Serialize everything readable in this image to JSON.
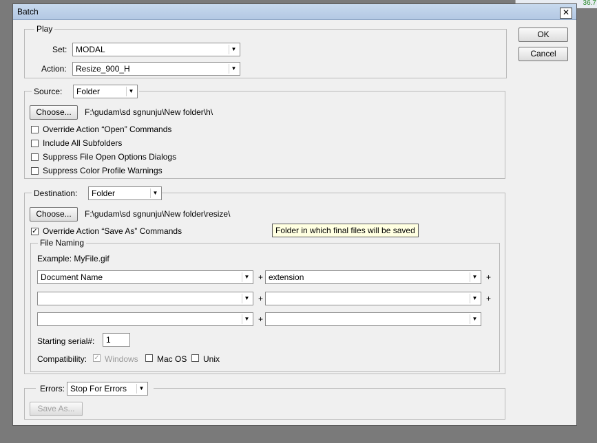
{
  "window": {
    "title": "Batch",
    "close_glyph": "✕"
  },
  "corner": {
    "zoom_text": "36.7"
  },
  "buttons": {
    "ok": "OK",
    "cancel": "Cancel"
  },
  "play": {
    "legend": "Play",
    "set_label": "Set:",
    "set_value": "MODAL",
    "action_label": "Action:",
    "action_value": "Resize_900_H"
  },
  "source": {
    "legend": "Source:",
    "value": "Folder",
    "choose_label": "Choose...",
    "path": "F:\\gudam\\sd sgnunju\\New folder\\h\\",
    "options": [
      {
        "label": "Override Action “Open” Commands",
        "checked": false
      },
      {
        "label": "Include All Subfolders",
        "checked": false
      },
      {
        "label": "Suppress File Open Options Dialogs",
        "checked": false
      },
      {
        "label": "Suppress Color Profile Warnings",
        "checked": false
      }
    ]
  },
  "destination": {
    "legend": "Destination:",
    "value": "Folder",
    "choose_label": "Choose...",
    "path": "F:\\gudam\\sd sgnunju\\New folder\\resize\\",
    "override_label": "Override Action “Save As” Commands",
    "override_checked": true,
    "tooltip": "Folder in which final files will be saved"
  },
  "file_naming": {
    "legend": "File Naming",
    "example": "Example: MyFile.gif",
    "fields": [
      [
        "Document Name",
        "extension"
      ],
      [
        "",
        ""
      ],
      [
        "",
        ""
      ]
    ],
    "plus": "+",
    "serial_label": "Starting serial#:",
    "serial_value": "1",
    "compat_label": "Compatibility:",
    "compat": [
      {
        "label": "Windows",
        "checked": true,
        "disabled": true
      },
      {
        "label": "Mac OS",
        "checked": false,
        "disabled": false
      },
      {
        "label": "Unix",
        "checked": false,
        "disabled": false
      }
    ]
  },
  "errors": {
    "label": "Errors:",
    "value": "Stop For Errors",
    "save_as_label": "Save As..."
  },
  "icons": {
    "dropdown": "chevron-down-icon",
    "check": "checkmark-icon"
  }
}
